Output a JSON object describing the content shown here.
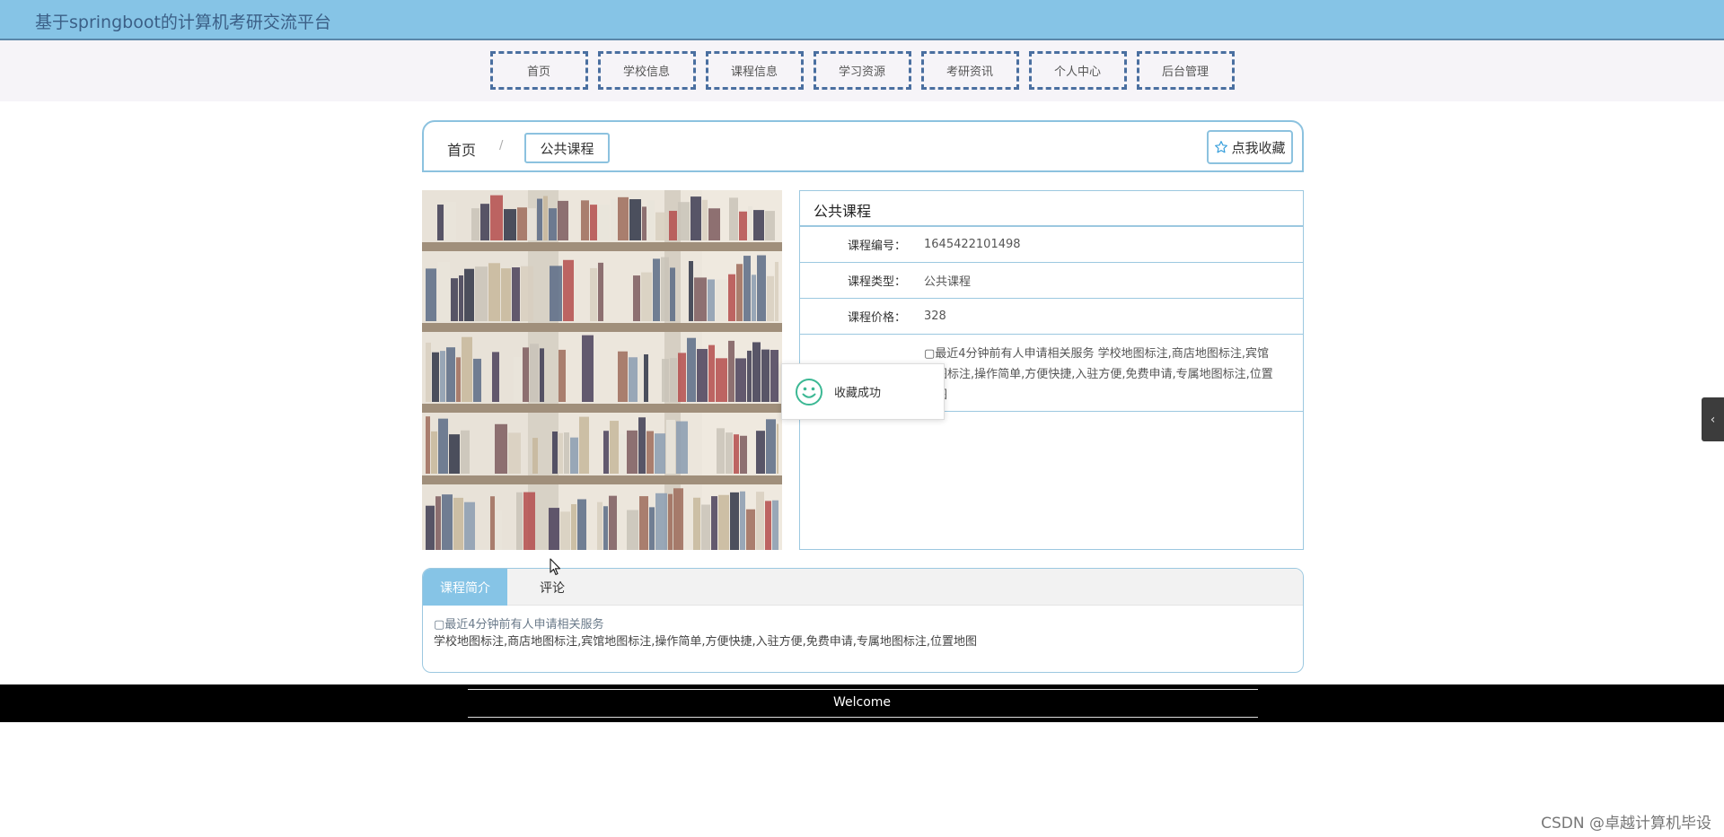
{
  "header": {
    "title": "基于springboot的计算机考研交流平台"
  },
  "nav": {
    "items": [
      "首页",
      "学校信息",
      "课程信息",
      "学习资源",
      "考研资讯",
      "个人中心",
      "后台管理"
    ]
  },
  "breadcrumb": {
    "home": "首页",
    "separator": "/",
    "current": "公共课程"
  },
  "favorite": {
    "label": "点我收藏",
    "icon": "star-icon"
  },
  "image": {
    "icon": "bookshelf-photo"
  },
  "detail": {
    "title": "公共课程",
    "rows": [
      {
        "label": "课程编号：",
        "value": "1645422101498"
      },
      {
        "label": "课程类型：",
        "value": "公共课程"
      },
      {
        "label": "课程价格：",
        "value": "328"
      }
    ],
    "description": "▢最近4分钟前有人申请相关服务 学校地图标注,商店地图标注,宾馆地图标注,操作简单,方便快捷,入驻方便,免费申请,专属地图标注,位置地图"
  },
  "toast": {
    "text": "收藏成功",
    "icon": "smile-icon"
  },
  "tabs": {
    "intro_label": "课程简介",
    "comment_label": "评论",
    "intro_line1": "▢最近4分钟前有人申请相关服务",
    "intro_line2": "学校地图标注,商店地图标注,宾馆地图标注,操作简单,方便快捷,入驻方便,免费申请,专属地图标注,位置地图"
  },
  "footer": {
    "text": "Welcome"
  },
  "side_toggle": {
    "icon": "chevron-left-icon",
    "glyph": "‹"
  },
  "watermark": {
    "text": "CSDN @卓越计算机毕设"
  },
  "colors": {
    "accent": "#86c4e6",
    "nav_border": "#4a6fa0",
    "panel_border": "#9cc8e0",
    "footer_bg": "#000000"
  }
}
